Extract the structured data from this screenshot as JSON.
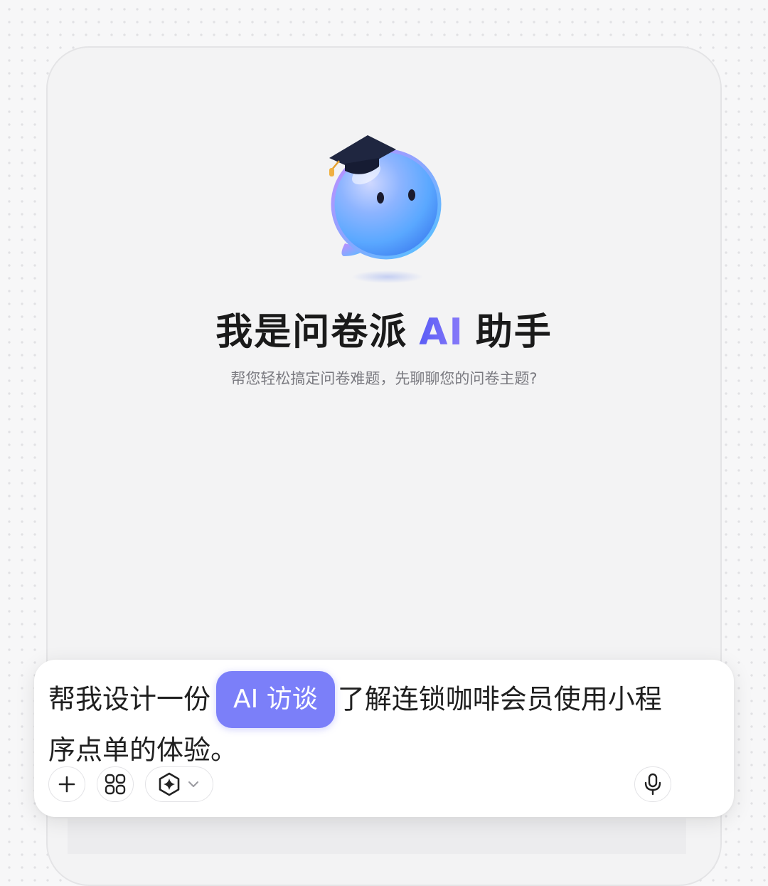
{
  "hero": {
    "title_prefix": "我是问卷派",
    "title_ai": "AI",
    "title_suffix": "助手",
    "subtitle": "帮您轻松搞定问卷难题，先聊聊您的问卷主题?"
  },
  "composer": {
    "prompt_before_chip": "帮我设计一份",
    "chip_label": "AI 访谈",
    "prompt_after_chip": "了解连锁咖啡会员使用小程",
    "prompt_line2": "序点单的体验。"
  },
  "toolbar": {
    "buttons": [
      {
        "name": "add",
        "icon": "plus-icon"
      },
      {
        "name": "apps",
        "icon": "apps-grid-icon"
      },
      {
        "name": "mode-selector",
        "icon": "ai-sparkle-icon",
        "dropdown_icon": "chevron-down-icon"
      },
      {
        "name": "voice",
        "icon": "microphone-icon"
      }
    ]
  },
  "colors": {
    "accent": "#7b7ff9",
    "accent_gradient_start": "#5a5cf6",
    "text_primary": "#1a1a1a",
    "text_secondary": "#7a7a80"
  }
}
